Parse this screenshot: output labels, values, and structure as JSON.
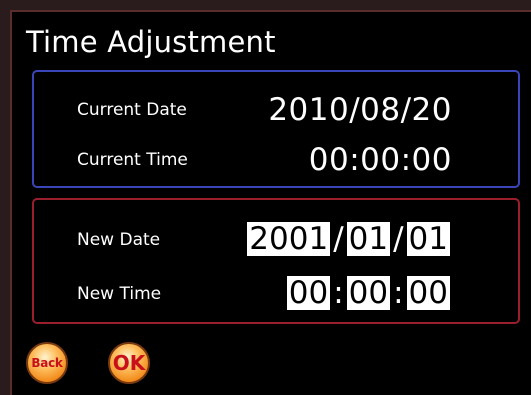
{
  "screen": {
    "title": "Time Adjustment"
  },
  "current": {
    "date_label": "Current Date",
    "date_value": "2010/08/20",
    "time_label": "Current Time",
    "time_value": "00:00:00"
  },
  "new": {
    "date_label": "New Date",
    "year": "2001",
    "month": "01",
    "day": "01",
    "date_sep": "/",
    "time_label": "New Time",
    "hour": "00",
    "minute": "00",
    "second": "00",
    "time_sep": ":"
  },
  "buttons": {
    "back_label": "Back",
    "ok_label": "OK"
  },
  "colors": {
    "current_border": "#3a46b8",
    "new_border": "#9a1f2c",
    "button_orange": "#f28a1a",
    "button_text": "#c8101a"
  }
}
